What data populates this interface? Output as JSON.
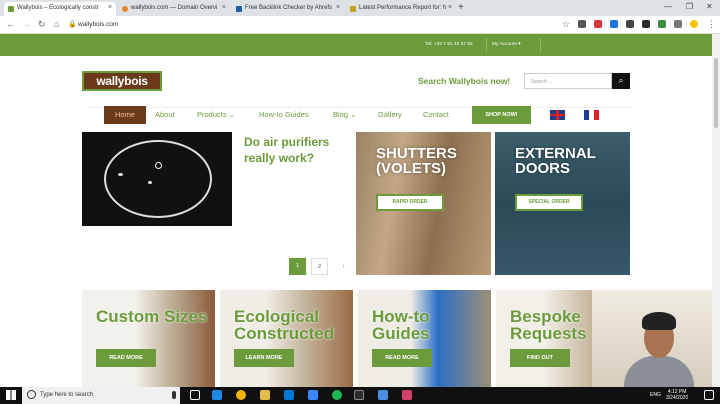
{
  "browser": {
    "tabs": [
      {
        "title": "Wallybois – Ecologically constr",
        "active": true,
        "color": "#6c9b3c"
      },
      {
        "title": "wallybois.com — Domain Overvi",
        "active": false,
        "color": "#e8862a"
      },
      {
        "title": "Free Backlink Checker by Ahrefs",
        "active": false,
        "color": "#1f5fa9"
      },
      {
        "title": "Latest Performance Report for: h",
        "active": false,
        "color": "#c8a21c"
      }
    ],
    "url": "wallybois.com"
  },
  "site": {
    "phone": "Tel: +33 7 81 45 37 82",
    "my_account": "My Account",
    "logo": "wallybois",
    "search_label": "Search Wallybois now!",
    "search_placeholder": "Search ...",
    "menu": [
      "Home",
      "About",
      "Products",
      "How-to Guides",
      "Blog",
      "Gallery",
      "Contact"
    ],
    "shop_now": "SHOP NOW!",
    "article_title": "Do air purifiers really work?",
    "pagination": [
      "1",
      "2",
      "›"
    ],
    "panels": [
      {
        "title": "SHUTTERS (VOLETS)",
        "button": "RAPID ORDER"
      },
      {
        "title": "EXTERNAL DOORS",
        "button": "SPECIAL ORDER"
      }
    ],
    "cards": [
      {
        "title": "Custom Sizes",
        "button": "READ MORE"
      },
      {
        "title": "Ecological Constructed",
        "button": "LEARN MORE"
      },
      {
        "title": "How-to Guides",
        "button": "READ MORE"
      },
      {
        "title": "Bespoke Requests",
        "button": "FIND OUT"
      }
    ]
  },
  "taskbar": {
    "search": "Type here to search",
    "lang": "ENG",
    "time": "4:12 PM",
    "date": "3/24/2020"
  }
}
